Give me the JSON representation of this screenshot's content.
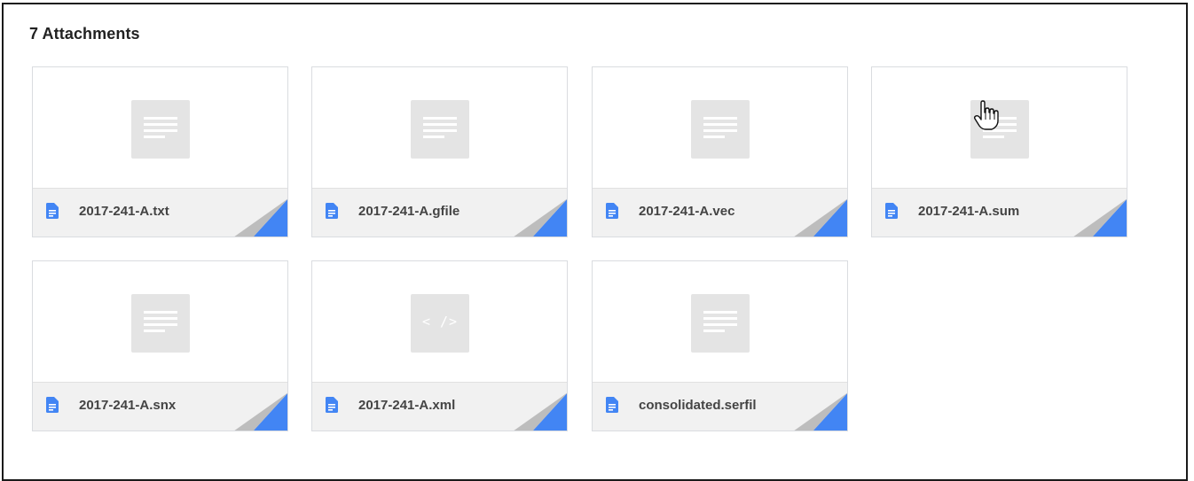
{
  "panel": {
    "title": "7 Attachments"
  },
  "attachments": [
    {
      "name": "2017-241-A.txt",
      "thumb_icon": "document-lines-icon"
    },
    {
      "name": "2017-241-A.gfile",
      "thumb_icon": "document-lines-icon"
    },
    {
      "name": "2017-241-A.vec",
      "thumb_icon": "document-lines-icon"
    },
    {
      "name": "2017-241-A.sum",
      "thumb_icon": "document-lines-icon"
    },
    {
      "name": "2017-241-A.snx",
      "thumb_icon": "document-lines-icon"
    },
    {
      "name": "2017-241-A.xml",
      "thumb_icon": "code-file-icon",
      "thumb_glyph": "< />"
    },
    {
      "name": "consolidated.serfil",
      "thumb_icon": "document-lines-icon"
    }
  ],
  "colors": {
    "file_icon": "#4285f4",
    "corner_fold_blue": "#4285f4",
    "corner_fold_gray": "#bdbdbd",
    "thumb_bg": "#e4e4e4"
  }
}
